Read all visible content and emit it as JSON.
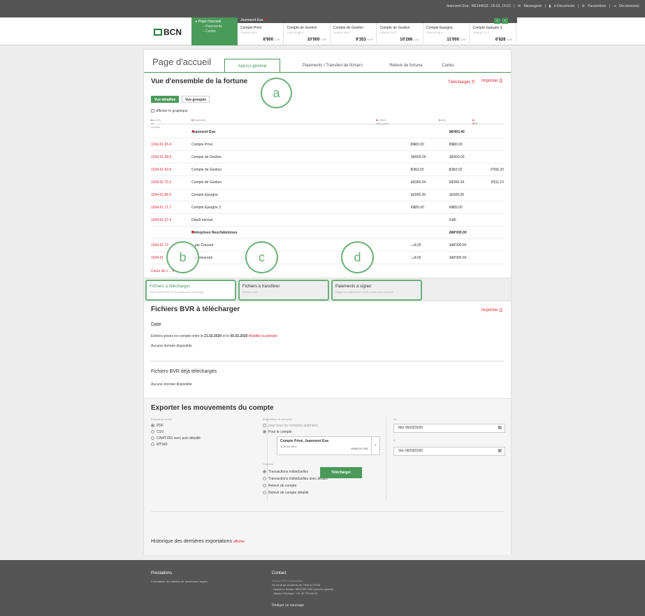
{
  "topbar": {
    "user_session": "Jeanneret Eva · NE144033 - 05.03. 14:53",
    "messages": "Messagerie",
    "edocs": "e-Documents",
    "settings": "Paramètres",
    "logout": "Déconnexion"
  },
  "logo": {
    "text": "BCN"
  },
  "nav": {
    "home": "Page d'accueil",
    "payments": "– Paiements",
    "cards": "– Cartes"
  },
  "accountbar": {
    "owner": "Jeanneret Eva"
  },
  "accounts": [
    {
      "name": "Compte Privé",
      "iban": "1034.61.65.4",
      "amount": "8'900",
      "ccy": "CHF"
    },
    {
      "name": "Compte de Gestion",
      "iban": "1034.61.68.9",
      "amount": "10'000",
      "ccy": "CHF"
    },
    {
      "name": "Compte de Gestion",
      "iban": "1034.61.69.4",
      "amount": "9'353",
      "ccy": "EUR"
    },
    {
      "name": "Compte de Gestion",
      "iban": "1034.61.70.2",
      "amount": "10'266",
      "ccy": "USD"
    },
    {
      "name": "Compte Epargne",
      "iban": "1034.61.66.9",
      "amount": "11'000",
      "ccy": "CHF"
    },
    {
      "name": "Compte Epargne 3",
      "iban": "1034.61.71.7",
      "amount": "6'826",
      "ccy": "CHF"
    }
  ],
  "page": {
    "title": "Page d'accueil"
  },
  "tabs": [
    "Aperçu général",
    "Paiements / Transfert de fichiers",
    "Relevé de fortune",
    "Cartes"
  ],
  "wealth": {
    "title": "Vue d'ensemble de la fortune",
    "download": "Télécharger",
    "print": "Imprimer",
    "view_detailed": "Vue détaillée",
    "view_grouped": "Vue groupée",
    "show_chart": "Afficher le graphique",
    "col_account": "Numéro de compte",
    "col_designation": "Désignation",
    "col_available": "Montant disponible",
    "col_balance": "Solde",
    "col_chf": "en CHF",
    "rows": [
      {
        "num": "",
        "desc": "Jeanneret Eva",
        "avail": "",
        "avail_ccy": "",
        "bal": "66'493.40",
        "bal_ccy": "CHF",
        "chf": "",
        "bold": true
      },
      {
        "num": "1034.61.65.4",
        "desc": "Compte Privé",
        "avail": "8'900.00",
        "avail_ccy": "CHF",
        "bal": "8'900.00",
        "bal_ccy": "CHF",
        "chf": ""
      },
      {
        "num": "1034.61.68.9",
        "desc": "Compte de Gestion",
        "avail": "10'000.00",
        "avail_ccy": "CHF",
        "bal": "10'000.00",
        "bal_ccy": "CHF",
        "chf": ""
      },
      {
        "num": "1034.61.69.4",
        "desc": "Compte de Gestion",
        "avail": "9'353.02",
        "avail_ccy": "EUR",
        "bal": "9'353.02",
        "bal_ccy": "EUR",
        "chf": "9'566.30"
      },
      {
        "num": "1034.61.70.2",
        "desc": "Compte de Gestion",
        "avail": "10'266.94",
        "avail_ccy": "USD",
        "bal": "10'266.94",
        "bal_ccy": "USD",
        "chf": "9'811.10"
      },
      {
        "num": "1034.61.66.9",
        "desc": "Compte Epargne",
        "avail": "11'000.00",
        "avail_ccy": "CHF",
        "bal": "11'000.00",
        "bal_ccy": "CHF",
        "chf": ""
      },
      {
        "num": "1034.61.71.7",
        "desc": "Compte Epargne 3",
        "avail": "6'826.00",
        "avail_ccy": "CHF",
        "bal": "6'826.00",
        "bal_ccy": "CHF",
        "chf": ""
      },
      {
        "num": "1034.61.67.4",
        "desc": "Dépôt normal",
        "avail": "",
        "avail_ccy": "",
        "bal": "0.00",
        "bal_ccy": "CHF",
        "chf": ""
      },
      {
        "num": "",
        "desc": "Entreprises Neuchâteloises",
        "avail": "",
        "avail_ccy": "",
        "bal": "200'000.00",
        "bal_ccy": "CHF",
        "chf": "",
        "bold": true
      },
      {
        "num": "1034.61.72",
        "desc": "…pte Courant",
        "avail": "…0.00",
        "avail_ccy": "CHF",
        "bal": "100'000.00",
        "bal_ccy": "CHF",
        "chf": ""
      },
      {
        "num": "1034.61",
        "desc": "…e trésorerie",
        "avail": "…0.00",
        "avail_ccy": "CHF",
        "bal": "100'000.00",
        "bal_ccy": "CHF",
        "chf": ""
      }
    ],
    "rates_link": "Cours de c…"
  },
  "callouts": [
    "a",
    "b",
    "c",
    "d"
  ],
  "subtabs": [
    {
      "title": "Fichiers à télécharger",
      "sub": "BVR (Camt 054) et mouvements de compte"
    },
    {
      "title": "Fichiers à transférer",
      "sub": "Fichiers ISO"
    },
    {
      "title": "Paiements à signer",
      "sub": "Signer les paiements et les ordres permanents"
    }
  ],
  "bvr": {
    "title": "Fichiers BVR à télécharger",
    "print": "Imprimer",
    "date_title": "Date",
    "date_text_pre": "Entrées prises en compte entre le",
    "date_from": "21.02.2020",
    "date_mid": "et le",
    "date_to": "05.03.2020",
    "modify": "Modifier la période",
    "no_data": "Aucune donnée disponible",
    "done_title": "Fichiers BVR déjà téléchargés",
    "done_no_data": "Aucune donnée disponible"
  },
  "export": {
    "title": "Exporter les mouvements du compte",
    "format_label": "Format du fichier",
    "formats": [
      "PDF",
      "CSV",
      "CAMT.053 avec avis détaillé",
      "MT940"
    ],
    "data_label": "Exportation de données",
    "data_all": "pour tous les comptes autorisés",
    "data_one": "Pour le compte",
    "acc_name": "Compte Privé, Jeanneret Eva",
    "acc_iban": "1034.61.65.4",
    "acc_amount": "8'900.00 CHF",
    "content_label": "Contenu",
    "contents": [
      "Transactions individuelles",
      "Transactions individuelles avec détails",
      "Relevé de compte",
      "Relevé de compte détaillé"
    ],
    "from_label": "De",
    "from_value": "Mer  05/02/2020",
    "to_label": "À",
    "to_value": "Ven  06/03/2020",
    "download": "Télécharger",
    "history": "Historique des dernières exportations",
    "history_link": "afficher"
  },
  "footer": {
    "services_title": "Prestations",
    "services_text": "Commande de bulletins de versement rouges",
    "contact_title": "Contact",
    "contact_line1": "Service BCN-Netbanking",
    "contact_line2": "Du lundi au vendredi, de 7h45 à 17h30",
    "contact_line3": "- depuis la Suisse: 0800 820 620 (numéro gratuit)",
    "contact_line4": "- depuis l'étranger: +41 32 723 68 00",
    "message_btn": "Rédiger un message"
  }
}
